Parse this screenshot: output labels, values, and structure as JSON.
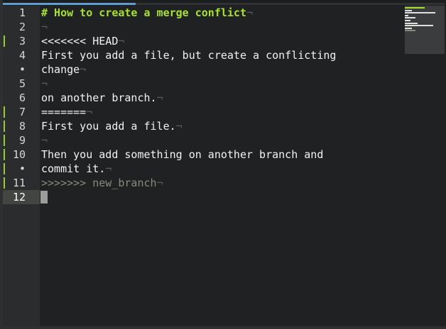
{
  "colors": {
    "accent": "#a6e22e",
    "change_marker": "#9acd32",
    "progress": "#5f9ccf"
  },
  "file_progress": 0.3,
  "gutter": [
    {
      "number": "1",
      "marker": false,
      "current": false
    },
    {
      "number": "2",
      "marker": false,
      "current": false
    },
    {
      "number": "3",
      "marker": true,
      "current": false
    },
    {
      "number": "4",
      "marker": false,
      "current": false
    },
    {
      "number": "•",
      "marker": false,
      "current": false
    },
    {
      "number": "5",
      "marker": false,
      "current": false
    },
    {
      "number": "6",
      "marker": false,
      "current": false
    },
    {
      "number": "7",
      "marker": true,
      "current": false
    },
    {
      "number": "8",
      "marker": true,
      "current": false
    },
    {
      "number": "9",
      "marker": true,
      "current": false
    },
    {
      "number": "10",
      "marker": true,
      "current": false
    },
    {
      "number": "•",
      "marker": true,
      "current": false
    },
    {
      "number": "11",
      "marker": true,
      "current": false
    },
    {
      "number": "12",
      "marker": false,
      "current": true
    }
  ],
  "editor": {
    "eol_mark": "¬",
    "lines": [
      {
        "text": "# How to create a merge conflict",
        "style": "heading",
        "eol": true
      },
      {
        "text": "",
        "style": "normal",
        "eol": true
      },
      {
        "text": "<<<<<<< HEAD",
        "style": "normal",
        "eol": true
      },
      {
        "text": "First you add a file, but create a conflicting",
        "style": "normal",
        "eol": false
      },
      {
        "text": "change",
        "style": "normal",
        "eol": true
      },
      {
        "text": "",
        "style": "normal",
        "eol": true
      },
      {
        "text": "on another branch.",
        "style": "normal",
        "eol": true
      },
      {
        "text": "=======",
        "style": "normal",
        "eol": true
      },
      {
        "text": "First you add a file.",
        "style": "normal",
        "eol": true
      },
      {
        "text": "",
        "style": "normal",
        "eol": true
      },
      {
        "text": "Then you add something on another branch and",
        "style": "normal",
        "eol": false
      },
      {
        "text": "commit it.",
        "style": "normal",
        "eol": true
      },
      {
        "text": ">>>>>>> new_branch",
        "style": "faded",
        "eol": true
      },
      {
        "text": "",
        "style": "normal",
        "eol": false
      }
    ],
    "cursor_row": 13
  },
  "minimap": [
    {
      "width": 0.55,
      "style": "hl"
    },
    {
      "width": 0.2,
      "style": "normal"
    },
    {
      "width": 0.85,
      "style": "normal"
    },
    {
      "width": 0.1,
      "style": "normal"
    },
    {
      "width": 0.3,
      "style": "normal"
    },
    {
      "width": 0.15,
      "style": "normal"
    },
    {
      "width": 0.35,
      "style": "normal"
    },
    {
      "width": 0.8,
      "style": "normal"
    },
    {
      "width": 0.2,
      "style": "normal"
    },
    {
      "width": 0.3,
      "style": "dim"
    }
  ]
}
